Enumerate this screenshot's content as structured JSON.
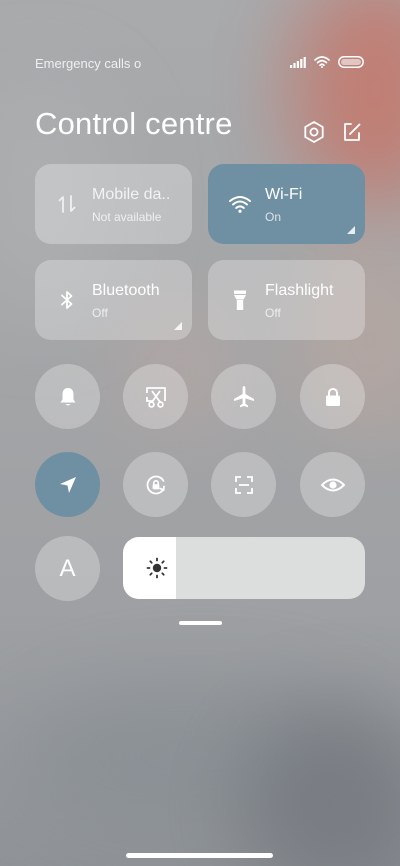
{
  "status_bar": {
    "carrier_text": "Emergency calls o",
    "icons": [
      "signal-icon",
      "wifi-icon",
      "battery-icon"
    ]
  },
  "header": {
    "title": "Control centre",
    "icons": [
      "gear-icon",
      "edit-icon"
    ]
  },
  "tiles": [
    {
      "label": "Mobile da..",
      "status": "Not available",
      "icon": "mobile-data-icon",
      "active": false
    },
    {
      "label": "Wi-Fi",
      "status": "On",
      "icon": "wifi-icon",
      "active": true
    },
    {
      "label": "Bluetooth",
      "status": "Off",
      "icon": "bluetooth-icon",
      "active": false
    },
    {
      "label": "Flashlight",
      "status": "Off",
      "icon": "flashlight-icon",
      "active": false
    }
  ],
  "toggles": [
    {
      "icon": "bell-icon",
      "active": false
    },
    {
      "icon": "screenshot-icon",
      "active": false
    },
    {
      "icon": "airplane-icon",
      "active": false
    },
    {
      "icon": "lock-icon",
      "active": false
    },
    {
      "icon": "location-icon",
      "active": true
    },
    {
      "icon": "rotation-lock-icon",
      "active": false
    },
    {
      "icon": "scan-icon",
      "active": false
    },
    {
      "icon": "eye-icon",
      "active": false
    }
  ],
  "auto_brightness": {
    "label": "A",
    "active": false
  },
  "brightness": {
    "level_fraction": 0.22,
    "icon": "sun-icon"
  },
  "colors": {
    "tile_active": "#6f8fa3",
    "tile_inactive": "rgba(255,255,255,0.28)",
    "text_primary": "#ffffff"
  }
}
